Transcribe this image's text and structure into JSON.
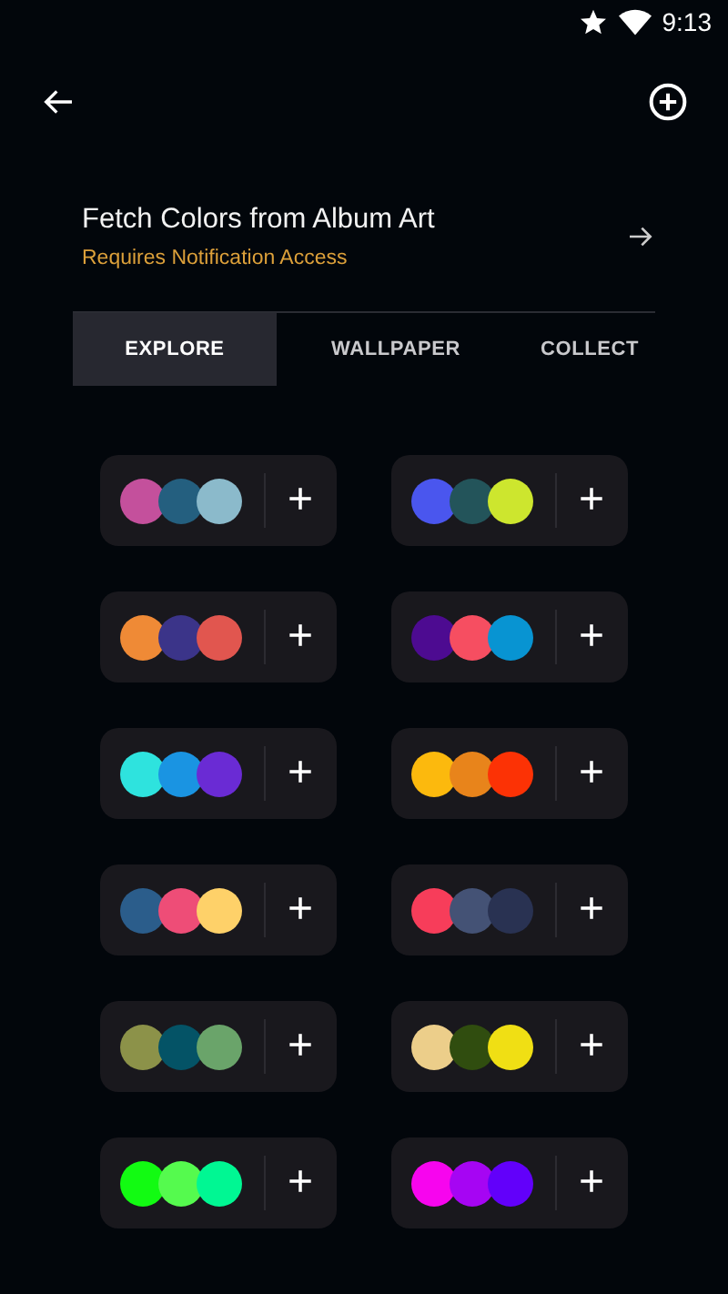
{
  "status_bar": {
    "time": "9:13"
  },
  "fetch": {
    "title": "Fetch Colors from Album Art",
    "subtitle": "Requires Notification Access"
  },
  "tabs": [
    {
      "label": "EXPLORE",
      "selected": true
    },
    {
      "label": "WALLPAPER",
      "selected": false
    },
    {
      "label": "COLLECT",
      "selected": false
    }
  ],
  "palettes": [
    {
      "swatches": [
        {
          "color": "#c4509c"
        },
        {
          "color": "#245f7f"
        },
        {
          "color": "#8bbacb"
        }
      ],
      "add_label": "+"
    },
    {
      "swatches": [
        {
          "color": "#4a56ee"
        },
        {
          "color": "#23545a"
        },
        {
          "color": "#cde62e"
        }
      ],
      "add_label": "+"
    },
    {
      "swatches": [
        {
          "color": "#ef8a36"
        },
        {
          "color": "#3b3489"
        },
        {
          "color": "#e1564f"
        }
      ],
      "add_label": "+"
    },
    {
      "swatches": [
        {
          "color": "#4d0b91"
        },
        {
          "color": "#f64e61"
        },
        {
          "color": "#0894d2"
        }
      ],
      "add_label": "+"
    },
    {
      "swatches": [
        {
          "color": "#2ee3de"
        },
        {
          "color": "#1a94e2"
        },
        {
          "color": "#6a2bd4"
        }
      ],
      "add_label": "+"
    },
    {
      "swatches": [
        {
          "color": "#fcb90d"
        },
        {
          "color": "#e8841b"
        },
        {
          "color": "#fc3205"
        }
      ],
      "add_label": "+"
    },
    {
      "swatches": [
        {
          "color": "#2b5d8b"
        },
        {
          "color": "#ee4d77"
        },
        {
          "color": "#fed169"
        }
      ],
      "add_label": "+"
    },
    {
      "swatches": [
        {
          "color": "#f73d5a"
        },
        {
          "color": "#445275"
        },
        {
          "color": "#293252"
        }
      ],
      "add_label": "+"
    },
    {
      "swatches": [
        {
          "color": "#8c9249"
        },
        {
          "color": "#045366"
        },
        {
          "color": "#6aa46a"
        }
      ],
      "add_label": "+"
    },
    {
      "swatches": [
        {
          "color": "#ecce8a"
        },
        {
          "color": "#304d0f"
        },
        {
          "color": "#f0df14"
        }
      ],
      "add_label": "+"
    },
    {
      "swatches": [
        {
          "color": "#12fb12"
        },
        {
          "color": "#55fa4e"
        },
        {
          "color": "#00f793"
        }
      ],
      "add_label": "+"
    },
    {
      "swatches": [
        {
          "color": "#f705ee"
        },
        {
          "color": "#a605f3"
        },
        {
          "color": "#6200fa"
        }
      ],
      "add_label": "+"
    }
  ]
}
